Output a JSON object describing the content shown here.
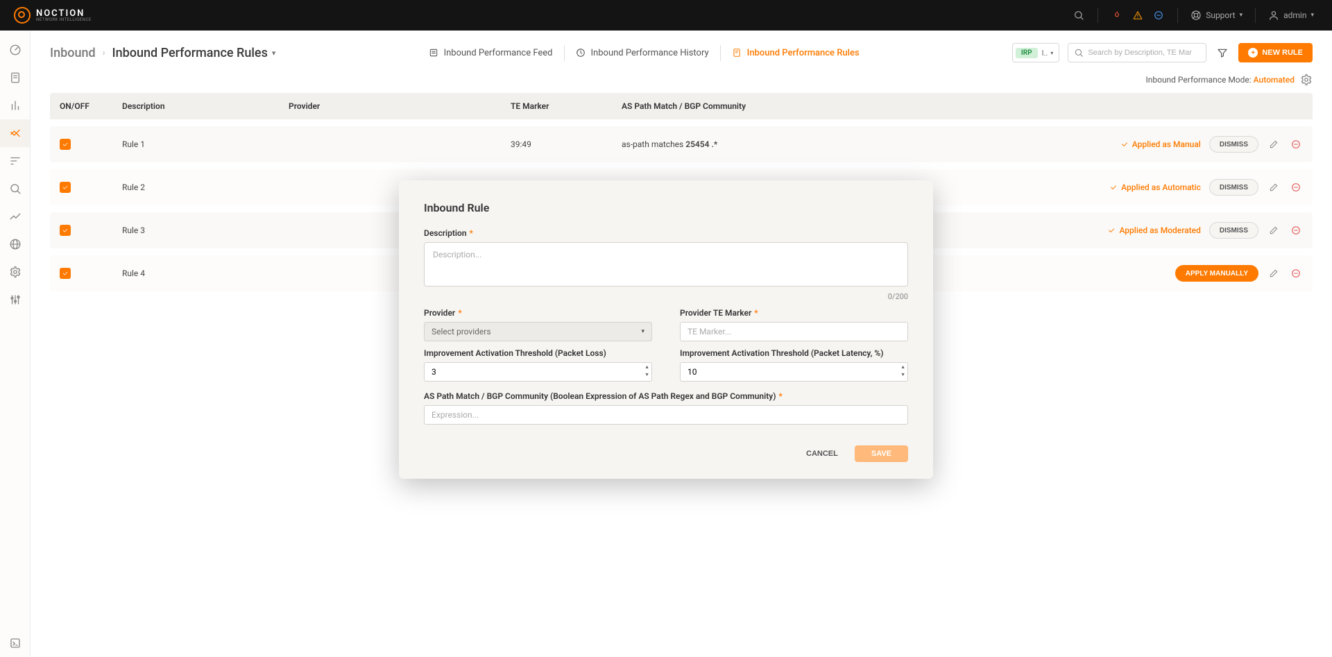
{
  "brand": {
    "name": "NOCTION",
    "tagline": "NETWORK INTELLIGENCE"
  },
  "topbar": {
    "support": "Support",
    "user": "admin"
  },
  "breadcrumb": {
    "parent": "Inbound",
    "current": "Inbound Performance Rules"
  },
  "subtabs": {
    "feed": "Inbound Performance Feed",
    "history": "Inbound Performance History",
    "rules": "Inbound Performance Rules"
  },
  "header_right": {
    "ip_badge": "IRP",
    "ip_mode": "I..",
    "search_placeholder": "Search by Description, TE Mar",
    "new_rule": "NEW RULE"
  },
  "mode_line": {
    "label": "Inbound Performance Mode: ",
    "value": "Automated"
  },
  "columns": {
    "onoff": "ON/OFF",
    "description": "Description",
    "provider": "Provider",
    "te_marker": "TE Marker",
    "match": "AS Path Match / BGP Community"
  },
  "rows": [
    {
      "desc": "Rule 1",
      "te": "39:49",
      "match_prefix": "as-path matches ",
      "match_bold": "25454 .*",
      "status": "Applied as Manual",
      "action": "DISMISS",
      "action_kind": "pill"
    },
    {
      "desc": "Rule 2",
      "te": "",
      "match_prefix": "",
      "match_bold": "",
      "status": "Applied as Automatic",
      "action": "DISMISS",
      "action_kind": "pill"
    },
    {
      "desc": "Rule 3",
      "te": "",
      "match_prefix": "",
      "match_bold": "",
      "status": "Applied as Moderated",
      "action": "DISMISS",
      "action_kind": "pill"
    },
    {
      "desc": "Rule 4",
      "te": "",
      "match_prefix": "",
      "match_bold": "",
      "status": "",
      "action": "APPLY MANUALLY",
      "action_kind": "apply"
    }
  ],
  "modal": {
    "title": "Inbound Rule",
    "description_label": "Description",
    "description_placeholder": "Description...",
    "char_count": "0/200",
    "provider_label": "Provider",
    "provider_placeholder": "Select providers",
    "te_marker_label": "Provider TE Marker",
    "te_marker_placeholder": "TE Marker...",
    "threshold_loss_label": "Improvement Activation Threshold (Packet Loss)",
    "threshold_loss_value": "3",
    "threshold_latency_label": "Improvement Activation Threshold (Packet Latency, %)",
    "threshold_latency_value": "10",
    "aspath_label": "AS Path Match / BGP Community (Boolean Expression of AS Path Regex and BGP Community)",
    "aspath_placeholder": "Expression...",
    "cancel": "CANCEL",
    "save": "SAVE"
  }
}
